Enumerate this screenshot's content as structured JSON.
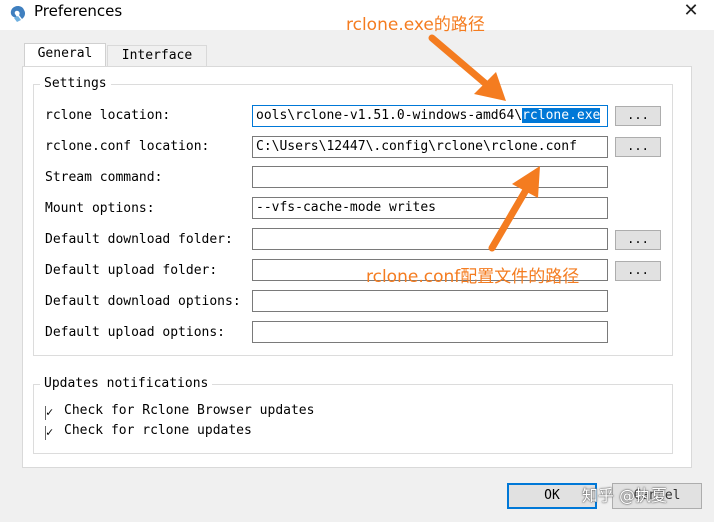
{
  "window": {
    "title": "Preferences",
    "close_glyph": "✕"
  },
  "tabs": [
    {
      "label": "General",
      "active": true
    },
    {
      "label": "Interface",
      "active": false
    }
  ],
  "settings": {
    "group_label": "Settings",
    "rows": [
      {
        "label": "rclone location:",
        "value_prefix": "ools\\rclone-v1.51.0-windows-amd64\\",
        "value_selected": "rclone.exe",
        "browse": "..."
      },
      {
        "label": "rclone.conf location:",
        "value": "C:\\Users\\12447\\.config\\rclone\\rclone.conf",
        "browse": "..."
      },
      {
        "label": "Stream command:",
        "value": ""
      },
      {
        "label": "Mount options:",
        "value": "--vfs-cache-mode writes"
      },
      {
        "label": "Default download folder:",
        "value": "",
        "browse": "..."
      },
      {
        "label": "Default upload folder:",
        "value": "",
        "browse": "..."
      },
      {
        "label": "Default download options:",
        "value": ""
      },
      {
        "label": "Default upload options:",
        "value": ""
      }
    ]
  },
  "updates": {
    "group_label": "Updates notifications",
    "checks": [
      {
        "label": "Check for Rclone Browser updates",
        "checked": true
      },
      {
        "label": "Check for rclone updates",
        "checked": true
      }
    ]
  },
  "buttons": {
    "ok": "OK",
    "cancel": "Cancel"
  },
  "annotations": {
    "exe_path": "rclone.exe的路径",
    "conf_path": "rclone.conf配置文件的路径",
    "color": "#f47c20"
  },
  "watermark": "知乎 @执夏",
  "colors": {
    "selection": "#0078d7",
    "dialog_bg": "#f0f0f0"
  }
}
